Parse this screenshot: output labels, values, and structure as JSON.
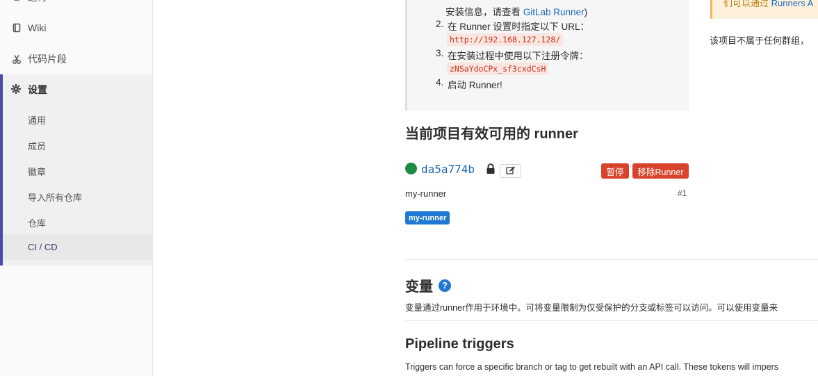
{
  "sidebar": {
    "top_partial_label": "运行",
    "items": [
      {
        "label": "Wiki",
        "icon": "book-icon"
      },
      {
        "label": "代码片段",
        "icon": "scissors-icon"
      }
    ],
    "settings": {
      "label": "设置",
      "icon": "gear-icon",
      "subitems": [
        "通用",
        "成员",
        "徽章",
        "导入所有仓库",
        "仓库",
        "CI / CD"
      ],
      "active": "CI / CD"
    }
  },
  "instructions": {
    "line1_prefix": "安装信息，请查看 ",
    "line1_link": "GitLab Runner",
    "line1_suffix": ")",
    "step2_num": "2.",
    "step2": "在 Runner 设置时指定以下 URL：",
    "url": "http://192.168.127.128/",
    "step3_num": "3.",
    "step3": "在安装过程中使用以下注册令牌：",
    "token": "zNSaYdoCPx_sf3cxdCsH",
    "step4_num": "4.",
    "step4": "启动 Runner!"
  },
  "runners": {
    "heading": "当前项目有效可用的 runner",
    "items": [
      {
        "id": "da5a774b",
        "status_color": "#1e8c45",
        "pause_label": "暂停",
        "remove_label": "移除Runner",
        "description": "my-runner",
        "number": "#1",
        "tags": [
          "my-runner"
        ]
      }
    ]
  },
  "variables": {
    "heading": "变量",
    "description": "变量通过runner作用于环境中。可将变量限制为仅受保护的分支或标签可以访问。可以使用变量来"
  },
  "pipeline_triggers": {
    "heading": "Pipeline triggers",
    "description": "Triggers can force a specific branch or tag to get rebuilt with an API call. These tokens will impers"
  },
  "right_column": {
    "warning_prefix": "们可以通过 ",
    "warning_link": "Runners A",
    "group_text": "该项目不属于任何群组，"
  }
}
